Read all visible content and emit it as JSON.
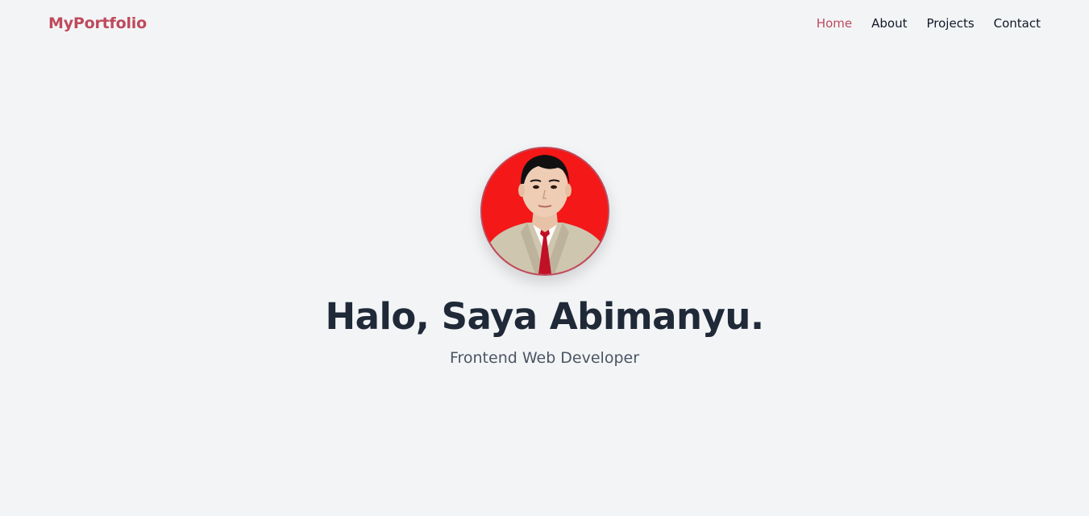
{
  "nav": {
    "brand": "MyPortfolio",
    "links": [
      {
        "label": "Home",
        "active": true
      },
      {
        "label": "About",
        "active": false
      },
      {
        "label": "Projects",
        "active": false
      },
      {
        "label": "Contact",
        "active": false
      }
    ]
  },
  "hero": {
    "title": "Halo, Saya Abimanyu.",
    "subtitle": "Frontend Web Developer",
    "avatar_icon": "profile-photo"
  },
  "colors": {
    "accent": "#be4a5c",
    "background": "#f3f4f6",
    "heading": "#1f2937",
    "subtitle": "#4b5563",
    "photo_background": "#f41818"
  }
}
